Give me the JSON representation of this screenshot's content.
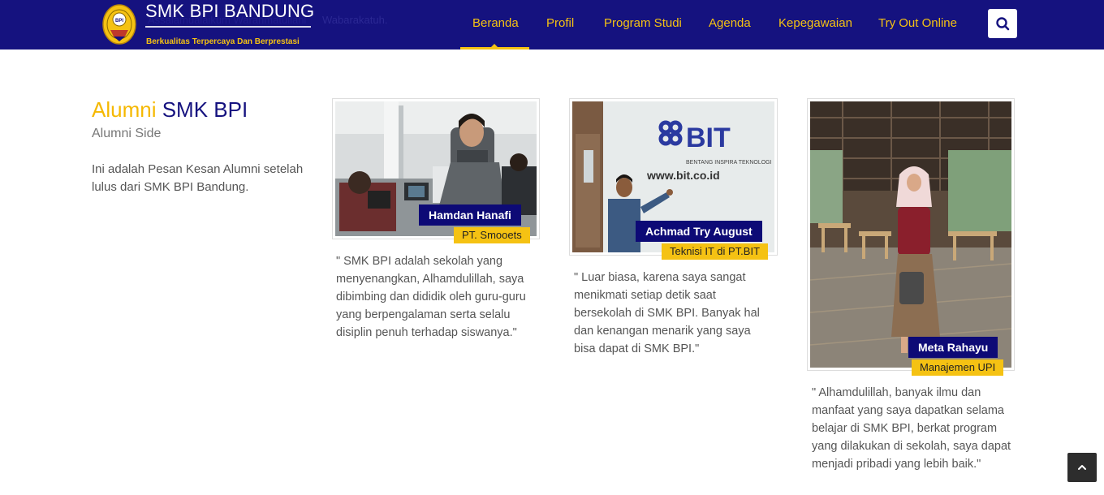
{
  "header": {
    "brand_title": "SMK BPI BANDUNG",
    "brand_tagline": "Berkualitas Terpercaya Dan Berprestasi",
    "ghost_marquee_right": "Wabarakatuh.",
    "nav": [
      {
        "label": "Beranda",
        "active": true
      },
      {
        "label": "Profil",
        "active": false
      },
      {
        "label": "Program Studi",
        "active": false
      },
      {
        "label": "Agenda",
        "active": false
      },
      {
        "label": "Kepegawaian",
        "active": false
      },
      {
        "label": "Try Out Online",
        "active": false
      }
    ],
    "search_icon": "search-icon",
    "colors": {
      "bar": "#15127f",
      "accent": "#f5c213"
    }
  },
  "intro": {
    "title_accent": "Alumni",
    "title_main": "SMK BPI",
    "subtitle": "Alumni Side",
    "description": "Ini adalah Pesan Kesan Alumni setelah lulus dari SMK BPI Bandung."
  },
  "alumni": [
    {
      "name": "Hamdan Hanafi",
      "company": "PT. Smooets",
      "quote": "\" SMK BPI adalah sekolah yang menyenangkan, Alhamdulillah, saya dibimbing dan dididik oleh guru-guru yang berpengalaman serta selalu disiplin penuh terhadap siswanya.\""
    },
    {
      "name": "Achmad Try August",
      "company": "Teknisi IT di PT.BIT",
      "quote": "\" Luar biasa, karena saya sangat menikmati setiap detik saat bersekolah di SMK BPI. Banyak hal dan kenangan menarik yang saya bisa dapat di SMK BPI.\"",
      "photo_sign": {
        "logo": "BIT",
        "tagline": "BENTANG INSPIRA TEKNOLOGI",
        "url": "www.bit.co.id"
      }
    },
    {
      "name": "Meta Rahayu",
      "company": "Manajemen UPI",
      "quote": "\" Alhamdulillah, banyak ilmu dan manfaat yang saya dapatkan selama belajar di SMK BPI, berkat program yang dilakukan di sekolah, saya dapat menjadi pribadi yang lebih baik.\""
    }
  ],
  "scroll_top_icon": "chevron-up-icon"
}
